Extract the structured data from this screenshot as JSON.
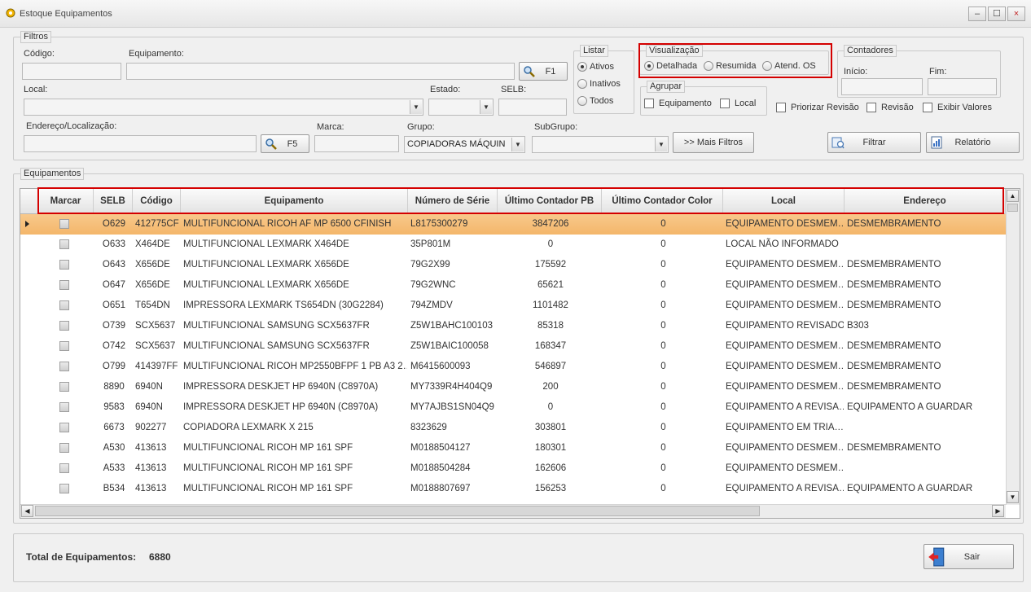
{
  "window": {
    "title": "Estoque Equipamentos",
    "min": "–",
    "max": "☐",
    "close": "×"
  },
  "filtros": {
    "legend": "Filtros",
    "codigo_label": "Código:",
    "equipamento_label": "Equipamento:",
    "f1_label": "F1",
    "local_label": "Local:",
    "estado_label": "Estado:",
    "selb_label": "SELB:",
    "endereco_label": "Endereço/Localização:",
    "f5_label": "F5",
    "marca_label": "Marca:",
    "grupo_label": "Grupo:",
    "grupo_value": "COPIADORAS MÁQUIN",
    "subgrupo_label": "SubGrupo:",
    "mais_filtros": ">> Mais Filtros"
  },
  "listar": {
    "legend": "Listar",
    "options": [
      "Ativos",
      "Inativos",
      "Todos"
    ],
    "selected": "Ativos"
  },
  "visualizacao": {
    "legend": "Visualização",
    "options": [
      "Detalhada",
      "Resumida",
      "Atend. OS"
    ],
    "selected": "Detalhada"
  },
  "agrupar": {
    "legend": "Agrupar",
    "options": [
      "Equipamento",
      "Local"
    ]
  },
  "contadores": {
    "legend": "Contadores",
    "inicio_label": "Início:",
    "fim_label": "Fim:"
  },
  "extra_checks": [
    "Priorizar Revisão",
    "Revisão",
    "Exibir Valores"
  ],
  "actions": {
    "filtrar": "Filtrar",
    "relatorio": "Relatório",
    "sair": "Sair"
  },
  "equipamentos": {
    "legend": "Equipamentos",
    "columns": [
      "Marcar",
      "SELB",
      "Código",
      "Equipamento",
      "Número de Série",
      "Último Contador PB",
      "Último Contador Color",
      "Local",
      "Endereço"
    ],
    "rows": [
      [
        "O629",
        "412775CF",
        "MULTIFUNCIONAL RICOH AF MP 6500 CFINISH",
        "L8175300279",
        "3847206",
        "0",
        "EQUIPAMENTO  DESMEM…",
        "DESMEMBRAMENTO"
      ],
      [
        "O633",
        "X464DE",
        "MULTIFUNCIONAL LEXMARK X464DE",
        "35P801M",
        "0",
        "0",
        "LOCAL NÃO INFORMADO",
        ""
      ],
      [
        "O643",
        "X656DE",
        "MULTIFUNCIONAL LEXMARK X656DE",
        "79G2X99",
        "175592",
        "0",
        "EQUIPAMENTO  DESMEM…",
        "DESMEMBRAMENTO"
      ],
      [
        "O647",
        "X656DE",
        "MULTIFUNCIONAL LEXMARK X656DE",
        "79G2WNC",
        "65621",
        "0",
        "EQUIPAMENTO  DESMEM…",
        "DESMEMBRAMENTO"
      ],
      [
        "O651",
        "T654DN",
        "IMPRESSORA LEXMARK TS654DN (30G2284)",
        "794ZMDV",
        "1101482",
        "0",
        "EQUIPAMENTO  DESMEM…",
        "DESMEMBRAMENTO"
      ],
      [
        "O739",
        "SCX5637",
        "MULTIFUNCIONAL SAMSUNG SCX5637FR",
        "Z5W1BAHC100103",
        "85318",
        "0",
        "EQUIPAMENTO REVISADO",
        "B303"
      ],
      [
        "O742",
        "SCX5637",
        "MULTIFUNCIONAL SAMSUNG SCX5637FR",
        "Z5W1BAIC100058",
        "168347",
        "0",
        "EQUIPAMENTO  DESMEM…",
        "DESMEMBRAMENTO"
      ],
      [
        "O799",
        "414397FF",
        "MULTIFUNCIONAL RICOH MP2550BFPF 1 PB A3 2…",
        "M6415600093",
        "546897",
        "0",
        "EQUIPAMENTO  DESMEM…",
        "DESMEMBRAMENTO"
      ],
      [
        "8890",
        "6940N",
        "IMPRESSORA DESKJET HP 6940N (C8970A)",
        "MY7339R4H404Q9",
        "200",
        "0",
        "EQUIPAMENTO  DESMEM…",
        "DESMEMBRAMENTO"
      ],
      [
        "9583",
        "6940N",
        "IMPRESSORA DESKJET HP 6940N (C8970A)",
        "MY7AJBS1SN04Q9",
        "0",
        "0",
        "EQUIPAMENTO  A  REVISA…",
        "EQUIPAMENTO A GUARDAR"
      ],
      [
        "6673",
        "902277",
        "COPIADORA LEXMARK X 215",
        "8323629",
        "303801",
        "0",
        "EQUIPAMENTO  EM  TRIA…",
        ""
      ],
      [
        "A530",
        "413613",
        "MULTIFUNCIONAL RICOH MP 161 SPF",
        "M0188504127",
        "180301",
        "0",
        "EQUIPAMENTO  DESMEM…",
        "DESMEMBRAMENTO"
      ],
      [
        "A533",
        "413613",
        "MULTIFUNCIONAL RICOH MP 161 SPF",
        "M0188504284",
        "162606",
        "0",
        "EQUIPAMENTO  DESMEM…",
        ""
      ],
      [
        "B534",
        "413613",
        "MULTIFUNCIONAL RICOH MP 161 SPF",
        "M0188807697",
        "156253",
        "0",
        "EQUIPAMENTO  A  REVISA…",
        "EQUIPAMENTO A GUARDAR"
      ]
    ]
  },
  "total": {
    "label": "Total de Equipamentos:",
    "value": "6880"
  },
  "colors": {
    "highlight": "#d40000",
    "selected_row": "#f6c07c"
  }
}
